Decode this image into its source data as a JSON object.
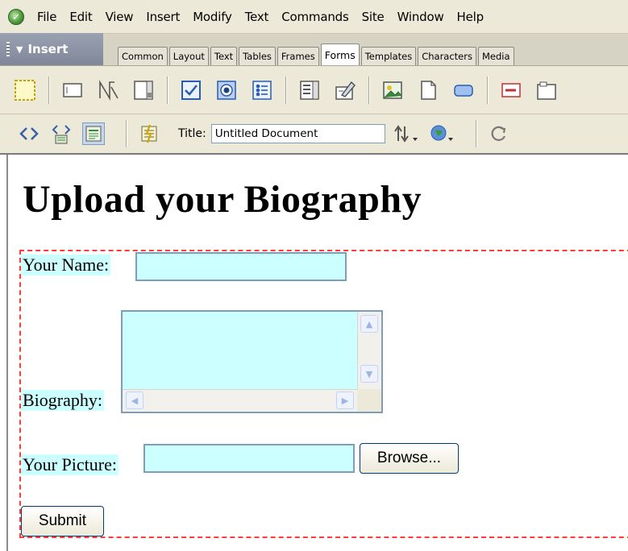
{
  "menubar": {
    "items": [
      "File",
      "Edit",
      "View",
      "Insert",
      "Modify",
      "Text",
      "Commands",
      "Site",
      "Window",
      "Help"
    ]
  },
  "insert_bar": {
    "title": "Insert",
    "tabs": [
      "Common",
      "Layout",
      "Text",
      "Tables",
      "Frames",
      "Forms",
      "Templates",
      "Characters",
      "Media"
    ],
    "active_tab": "Forms"
  },
  "forms_toolbar": {
    "icons": [
      "form-icon",
      "text-field-icon",
      "hidden-field-icon",
      "textarea-icon",
      "checkbox-icon",
      "radio-button-icon",
      "radio-group-icon",
      "list-menu-icon",
      "jump-menu-icon",
      "image-field-icon",
      "file-field-icon",
      "button-icon",
      "label-icon",
      "fieldset-icon"
    ]
  },
  "doc_toolbar": {
    "title_label": "Title:",
    "title_value": "Untitled Document"
  },
  "document": {
    "heading": "Upload your Biography",
    "name_label": "Your Name:",
    "biography_label": "Biography:",
    "picture_label": "Your Picture:",
    "browse_label": "Browse...",
    "submit_label": "Submit"
  },
  "colors": {
    "field_bg": "#ccffff",
    "form_outline": "#ff3b3b",
    "insert_title_bg": "#8a91a3"
  }
}
